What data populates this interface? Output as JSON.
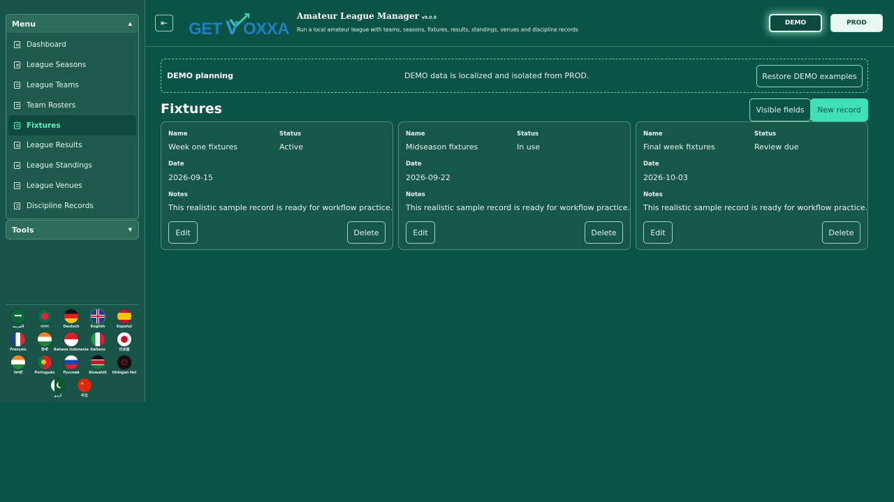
{
  "sidebar": {
    "menu_title": "Menu",
    "items": [
      {
        "label": "Dashboard"
      },
      {
        "label": "League Seasons"
      },
      {
        "label": "League Teams"
      },
      {
        "label": "Team Rosters"
      },
      {
        "label": "Fixtures",
        "active": true
      },
      {
        "label": "League Results"
      },
      {
        "label": "League Standings"
      },
      {
        "label": "League Venues"
      },
      {
        "label": "Discipline Records"
      }
    ],
    "tools_title": "Tools",
    "languages": [
      {
        "label": "العربية",
        "icon": "saudi-flag-icon"
      },
      {
        "label": "বাংলা",
        "icon": "bangladesh-flag-icon"
      },
      {
        "label": "Deutsch",
        "icon": "germany-flag-icon"
      },
      {
        "label": "English",
        "icon": "uk-flag-icon",
        "selected": true
      },
      {
        "label": "Español",
        "icon": "spain-flag-icon"
      },
      {
        "label": "Français",
        "icon": "france-flag-icon"
      },
      {
        "label": "हिन्दी",
        "icon": "india-flag-icon"
      },
      {
        "label": "Bahasa Indonesia",
        "icon": "indonesia-flag-icon"
      },
      {
        "label": "Italiano",
        "icon": "italy-flag-icon"
      },
      {
        "label": "日本語",
        "icon": "japan-flag-icon"
      },
      {
        "label": "ਪੰਜਾਬੀ",
        "icon": "india-flag-icon"
      },
      {
        "label": "Português",
        "icon": "portugal-flag-icon"
      },
      {
        "label": "Русский",
        "icon": "russia-flag-icon"
      },
      {
        "label": "Kiswahili",
        "icon": "kenya-flag-icon"
      },
      {
        "label": "tlhIngan Hol",
        "icon": "klingon-flag-icon"
      },
      {
        "label": "اردو",
        "icon": "pakistan-flag-icon"
      },
      {
        "label": "中文",
        "icon": "china-flag-icon"
      }
    ]
  },
  "header": {
    "logo_text": "GETVOXXA",
    "app_title": "Amateur League Manager",
    "version": "v9.0.0",
    "subtitle": "Run a local amateur league with teams, seasons, fixtures, results, standings, venues and discipline records",
    "demo_label": "DEMO",
    "prod_label": "PROD"
  },
  "banner": {
    "title": "DEMO planning",
    "text": "DEMO data is localized and isolated from PROD.",
    "restore_label": "Restore DEMO examples"
  },
  "main": {
    "title": "Fixtures",
    "visible_fields_label": "Visible fields",
    "new_record_label": "New record",
    "labels": {
      "name": "Name",
      "status": "Status",
      "date": "Date",
      "notes": "Notes"
    },
    "edit_label": "Edit",
    "delete_label": "Delete",
    "records": [
      {
        "name": "Week one fixtures",
        "status": "Active",
        "date": "2026-09-15",
        "notes": "This realistic sample record is ready for workflow practice."
      },
      {
        "name": "Midseason fixtures",
        "status": "In use",
        "date": "2026-09-22",
        "notes": "This realistic sample record is ready for workflow practice."
      },
      {
        "name": "Final week fixtures",
        "status": "Review due",
        "date": "2026-10-03",
        "notes": "This realistic sample record is ready for workflow practice."
      }
    ]
  },
  "colors": {
    "background": "#0b5344",
    "accent": "#3fe0b4",
    "active_menu_text": "#5ef0c3"
  }
}
